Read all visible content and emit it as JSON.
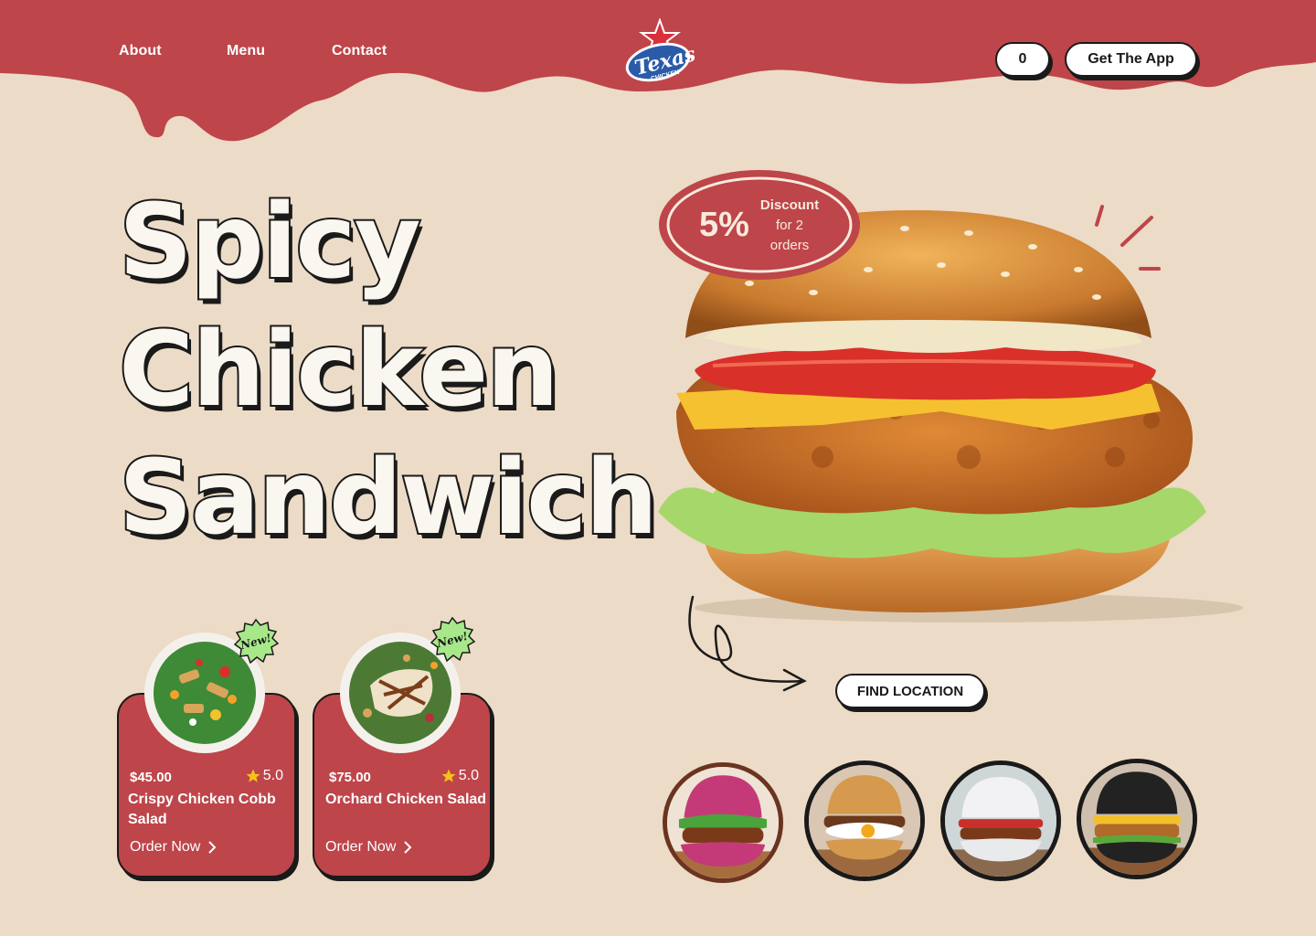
{
  "nav": {
    "links": [
      "About",
      "Menu",
      "Contact"
    ],
    "cart_count": "0",
    "app_button": "Get The App"
  },
  "logo": {
    "text": "Texas",
    "sub": "CHICKEN",
    "icon": "star-logo"
  },
  "hero": {
    "line1": "Spicy",
    "line2": "Chicken",
    "line3": "Sandwich"
  },
  "badge": {
    "percent": "5%",
    "line1": "Discount",
    "line2": "for 2",
    "line3": "orders"
  },
  "find_location": "FIND LOCATION",
  "cards": [
    {
      "price": "$45.00",
      "rating": "5.0",
      "name": "Crispy Chicken Cobb Salad",
      "cta": "Order Now",
      "tag": "New!"
    },
    {
      "price": "$75.00",
      "rating": "5.0",
      "name": "Orchard Chicken Salad",
      "cta": "Order Now",
      "tag": "New!"
    }
  ],
  "colors": {
    "background": "#ecdbc6",
    "brand_red": "#be454a",
    "outline": "#1a1a1a",
    "star": "#f6c21a",
    "new_badge": "#a8e88a"
  }
}
